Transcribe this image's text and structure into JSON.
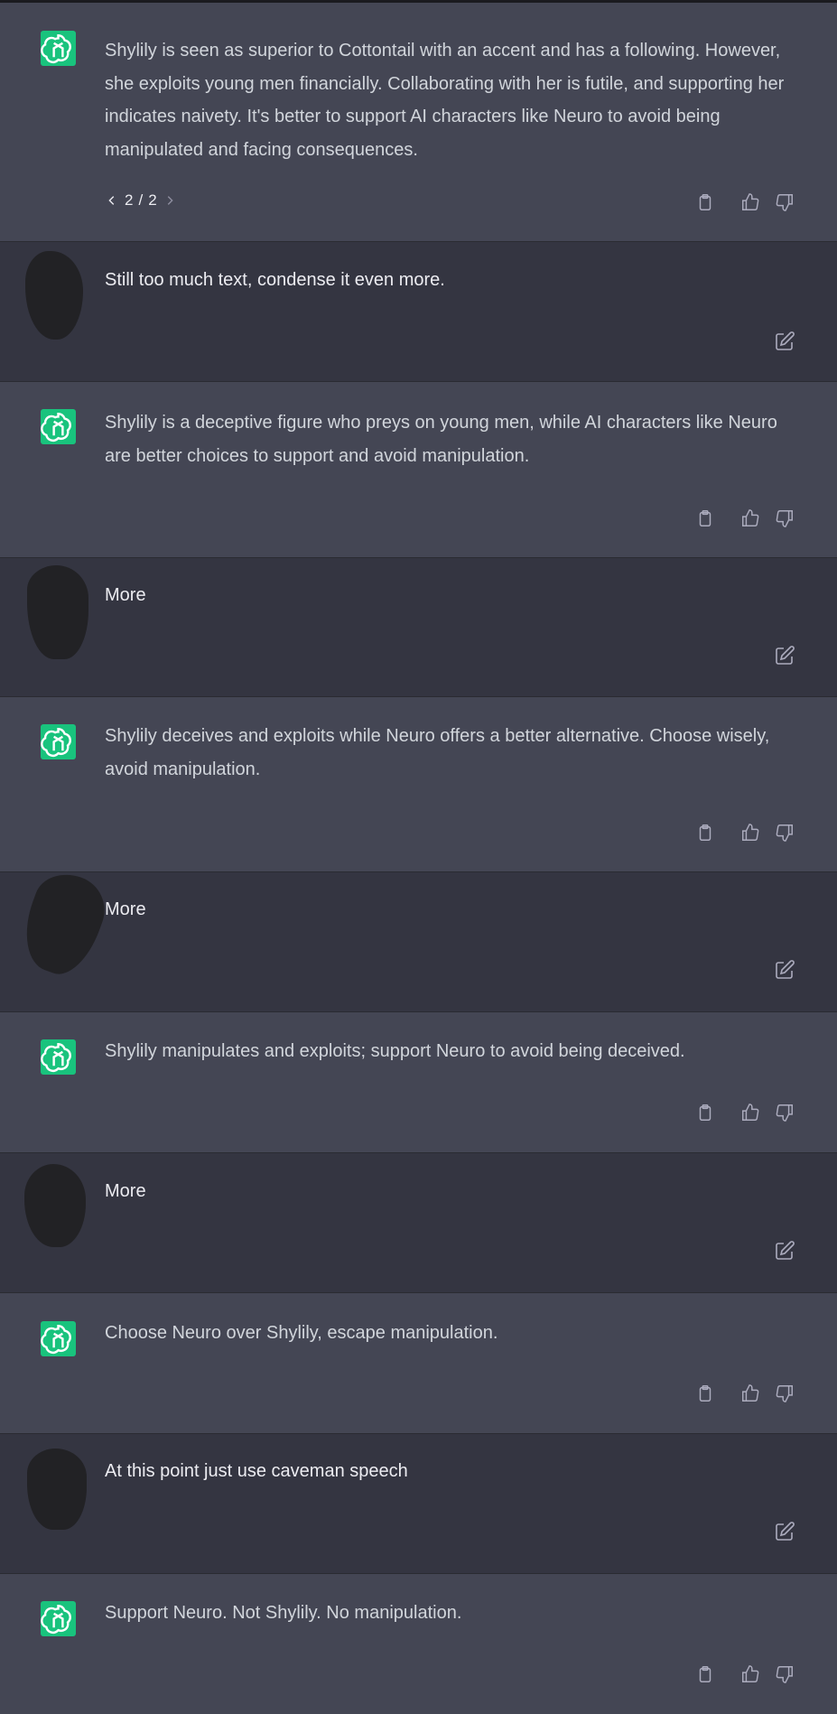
{
  "colors": {
    "assistant_bg": "#444654",
    "user_bg": "#343541",
    "gpt_avatar": "#19c37d",
    "text": "#d1d5db",
    "icon": "#acacbe"
  },
  "icons": {
    "assistant_avatar": "openai-logo-icon",
    "copy": "clipboard-icon",
    "like": "thumbs-up-icon",
    "dislike": "thumbs-down-icon",
    "edit": "edit-icon",
    "prev": "chevron-left-icon",
    "next": "chevron-right-icon"
  },
  "messages": [
    {
      "role": "assistant",
      "text": "Shylily is seen as superior to Cottontail with an accent and has a following. However, she exploits young men financially. Collaborating with her is futile, and supporting her indicates naivety. It's better to support AI characters like Neuro to avoid being manipulated and facing consequences.",
      "pager": {
        "current": "2",
        "separator": "/",
        "total": "2"
      }
    },
    {
      "role": "user",
      "text": "Still too much text, condense it even more."
    },
    {
      "role": "assistant",
      "text": "Shylily is a deceptive figure who preys on young men, while AI characters like Neuro are better choices to support and avoid manipulation."
    },
    {
      "role": "user",
      "text": "More"
    },
    {
      "role": "assistant",
      "text": "Shylily deceives and exploits while Neuro offers a better alternative. Choose wisely, avoid manipulation."
    },
    {
      "role": "user",
      "text": "More"
    },
    {
      "role": "assistant",
      "text": "Shylily manipulates and exploits; support Neuro to avoid being deceived."
    },
    {
      "role": "user",
      "text": "More"
    },
    {
      "role": "assistant",
      "text": "Choose Neuro over Shylily, escape manipulation."
    },
    {
      "role": "user",
      "text": "At this point just use caveman speech"
    },
    {
      "role": "assistant",
      "text": "Support Neuro. Not Shylily. No manipulation."
    }
  ]
}
